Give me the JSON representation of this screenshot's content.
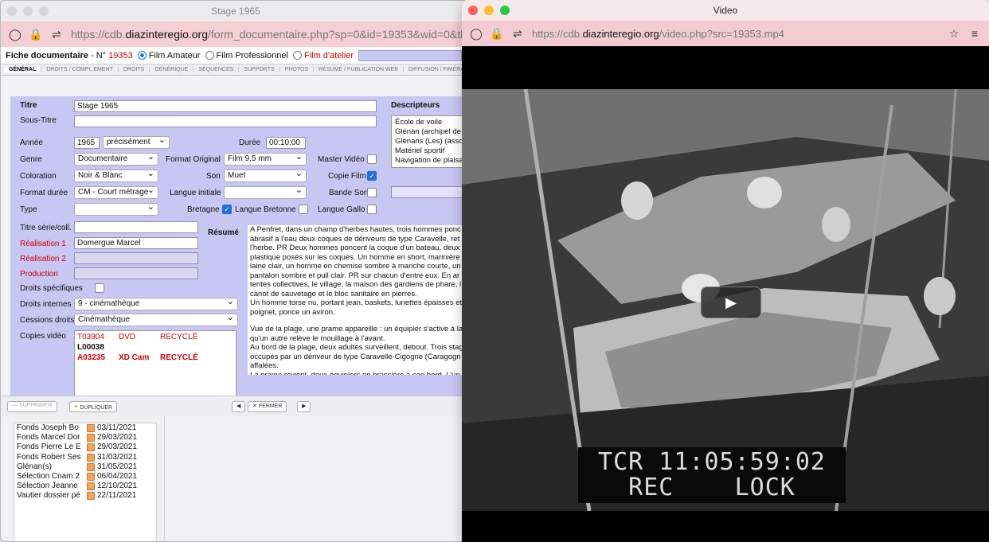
{
  "left_window": {
    "title": "Stage 1965",
    "url_prefix": "https://cdb.",
    "url_domain": "diazinteregio.org",
    "url_rest": "/form_documentaire.php?sp=0&id=19353&wid=0&tbl_id=4",
    "fiche_label": "Fiche documentaire",
    "fiche_num_prefix": " - N° ",
    "fiche_num": "19353",
    "radio_amateur": "Film Amateur",
    "radio_pro": "Film Professionnel",
    "radio_atelier": "Film d'atelier",
    "tabs": [
      "Général",
      "Droits / Compl.ement",
      "Droits",
      "Générique",
      "Séquences",
      "Supports",
      "Photos",
      "Résumé / Publication web",
      "Diffusion / Fiméra"
    ]
  },
  "form": {
    "titre_label": "Titre",
    "titre_value": "Stage 1965",
    "soustitre_label": "Sous-Titre",
    "soustitre_value": "",
    "annee_label": "Année",
    "annee_value": "1965",
    "precision_value": "précisément",
    "duree_label": "Durée",
    "duree_value": "00:10:00",
    "genre_label": "Genre",
    "genre_value": "Documentaire",
    "format_original_label": "Format Original",
    "format_original_value": "Film 9,5 mm",
    "master_video_label": "Master Vidéo",
    "coloration_label": "Coloration",
    "coloration_value": "Noir & Blanc",
    "son_label": "Son",
    "son_value": "Muet",
    "copie_film_label": "Copie Film",
    "format_duree_label": "Format durée",
    "format_duree_value": "CM - Court métrage",
    "langue_initiale_label": "Langue initiale",
    "langue_initiale_value": "",
    "bande_son_label": "Bande Son",
    "type_label": "Type",
    "type_value": "",
    "bretagne_label": "Bretagne",
    "langue_bretonne_label": "Langue Bretonne",
    "langue_gallo_label": "Langue Gallo",
    "titre_serie_label": "Titre série/coll.",
    "realisation1_label": "Réalisation 1",
    "realisation1_value": "Domergue Marcel",
    "realisation2_label": "Réalisation 2",
    "production_label": "Production",
    "droits_specifiques_label": "Droits spécifiques",
    "droits_internes_label": "Droits internes",
    "droits_internes_value": "9 - cinémathèque",
    "cessions_droits_label": "Cessions droits",
    "cessions_droits_value": "Cinémathèque",
    "copies_video_label": "Copies vidéo",
    "copies": [
      {
        "code": "T03904",
        "support": "DVD",
        "state": "RECYCLÉ"
      },
      {
        "code": "L00038",
        "support": "",
        "state": ""
      },
      {
        "code": "A03235",
        "support": "XD Cam",
        "state": "RECYCLÉ"
      }
    ],
    "resume_label": "Résumé",
    "resume_p1": "A Penfret, dans un champ d'herbes hautes, trois hommes ponc\nabrasif à l'eau deux coques de dériveurs de type Caravelle, ret\nl'herbe. PR Deux hommes poncent la coque d'un bateau, deux\nplastique posés sur les coques. Un homme en short, marinière\nlaine clair, un homme en chemise sombre à manche courte, un\npantalon sombre et pull clair. PR sur chacun d'entre eux. En ar\ntentes collectives, le village, la maison des gardiens de phare, l\ncanot de sauvetage et le bloc sanitaire en pierres.\nUn homme torse nu, portant jean, baskets, lunettes épaisses et\npoignet, ponce un aviron.",
    "resume_p2": "Vue de la plage, une prame appareille : un équipier s'active à la\nqu'un autre relève le mouillage à l'avant.\nAu bord de la plage, deux adultes surveillent, debout. Trois stag\noccupés par un dériveur de type Caravelle-Cigogne (Caragogn\naffalées.\nLa prame revient, deux équipiers en brassière à son bord. L'un\naidé de deux autres, tire l'arrière de l'embarcation à terre. L'équ\nmoteur sur le tableau arrière. Un homme pipe à la bouche. La p",
    "descripteurs_label": "Descripteurs",
    "descripteurs": [
      "École de voile",
      "Glénan (archipel de",
      "Glénans (Les) (asso",
      "Matériel sportif",
      "Navigation de plaisa"
    ]
  },
  "footer": {
    "supprimer": "Supprimer",
    "dupliquer": "Dupliquer",
    "fermer": "Fermer"
  },
  "list": [
    {
      "name": "Fonds Joseph Bo",
      "date": "03/11/2021"
    },
    {
      "name": "Fonds Marcel Dor",
      "date": "29/03/2021"
    },
    {
      "name": "Fonds Pierre Le E",
      "date": "29/03/2021"
    },
    {
      "name": "Fonds Robert Ses",
      "date": "31/03/2021"
    },
    {
      "name": "Glénan(s)",
      "date": "31/05/2021"
    },
    {
      "name": "Sélection Cnam 2",
      "date": "06/04/2021"
    },
    {
      "name": "Sélection Jeanne",
      "date": "12/10/2021"
    },
    {
      "name": "Vautier dossier pé",
      "date": "22/11/2021"
    }
  ],
  "right_window": {
    "title": "Video",
    "url_prefix": "https://cdb.",
    "url_domain": "diazinteregio.org",
    "url_rest": "/video.php?src=19353.mp4",
    "tcr_line1": "TCR 11:05:59:02",
    "tcr_line2": "REC    LOCK"
  },
  "colors": {
    "form_bg": "#c8c6f2",
    "url_bar_pink": "#f4cfd3",
    "accent_blue": "#1f6fe0",
    "label_red": "#c00000"
  }
}
